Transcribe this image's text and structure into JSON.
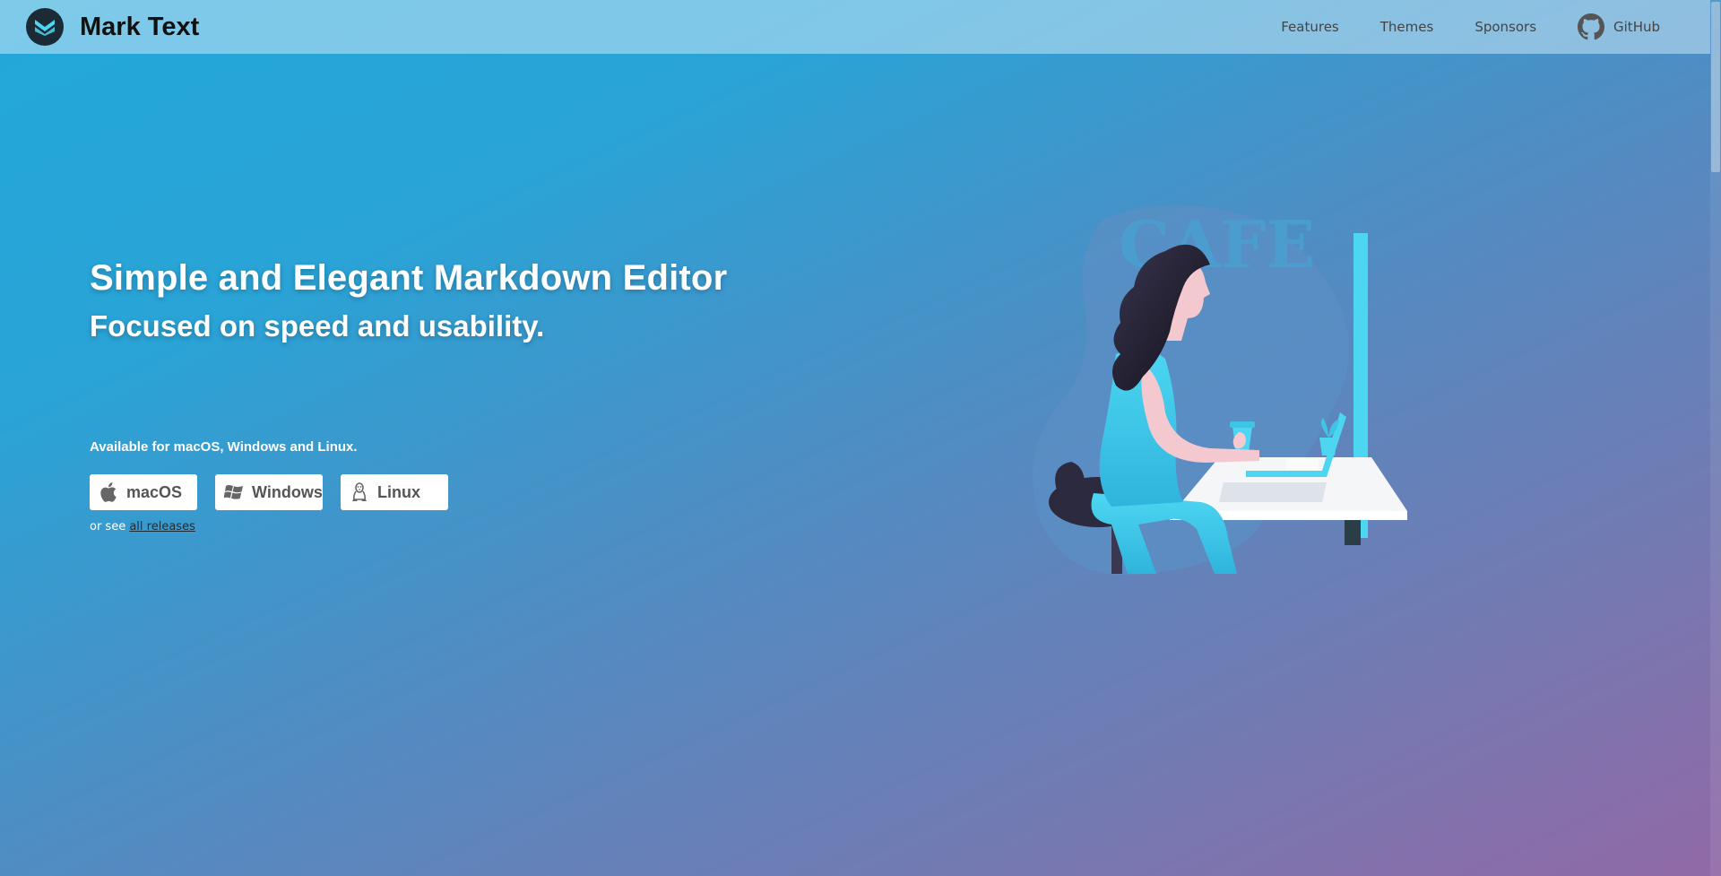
{
  "brand": {
    "name": "Mark Text",
    "logo_icon": "mark-text-logo-icon"
  },
  "nav": {
    "items": [
      {
        "label": "Features"
      },
      {
        "label": "Themes"
      },
      {
        "label": "Sponsors"
      },
      {
        "label": "GitHub",
        "icon": "github-icon"
      }
    ]
  },
  "hero": {
    "title": "Simple and Elegant Markdown Editor",
    "subtitle": "Focused on speed and usability."
  },
  "downloads": {
    "available_text": "Available for macOS, Windows and Linux.",
    "buttons": [
      {
        "label": "macOS",
        "icon": "apple-icon"
      },
      {
        "label": "Windows",
        "icon": "windows-icon"
      },
      {
        "label": "Linux",
        "icon": "linux-icon"
      }
    ],
    "or_see_text": "or see",
    "all_releases_link": "all releases"
  },
  "illustration": {
    "sign_text": "CAFE"
  },
  "colors": {
    "gradient_start": "#22a8da",
    "gradient_end": "#9169a6",
    "navbar": "#c8e6f5",
    "logo_bg": "#1b2a35",
    "accent_cyan": "#4dd6f2"
  }
}
